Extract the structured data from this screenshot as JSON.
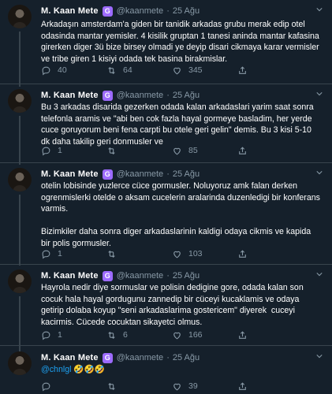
{
  "author": {
    "name": "M. Kaan Mete",
    "badge": "G",
    "handle": "@kaanmete",
    "separator": "·"
  },
  "tweets": [
    {
      "date": "25 Ağu",
      "text": "Arkadaşın amsterdam'a giden bir tanidik arkadas grubu merak edip otel odasinda mantar yemisler. 4 kisilik gruptan 1 tanesi aninda mantar kafasina girerken diger 3ü bize birsey olmadi ye deyip disari cikmaya karar vermisler ve tribe giren 1 kisiyi odada tek basina birakmislar.",
      "replies": "40",
      "retweets": "64",
      "likes": "345"
    },
    {
      "date": "25 Ağu",
      "text": "Bu 3 arkadas disarida gezerken odada kalan arkadaslari yarim saat sonra telefonla aramis ve \"abi ben cok fazla hayal gormeye basladim, her yerde cuce goruyorum beni fena carpti bu otele geri gelin\" demis. Bu 3 kisi 5-10 dk daha takilip geri donmusler ve",
      "replies": "1",
      "retweets": "",
      "likes": "85"
    },
    {
      "date": "25 Ağu",
      "text": "otelin lobisinde yuzlerce cüce gormusler. Noluyoruz amk falan derken ogrenmislerki otelde o aksam cucelerin aralarinda duzenledigi bir konferans varmis.\n\nBizimkiler daha sonra diger arkadaslarinin kaldigi odaya cikmis ve kapida bir polis gormusler.",
      "replies": "1",
      "retweets": "",
      "likes": "103"
    },
    {
      "date": "25 Ağu",
      "text": "Hayrola nedir diye sormuslar ve polisin dedigine gore, odada kalan son cocuk hala hayal gordugunu zannedip bir cüceyi kucaklamis ve odaya getirip dolaba koyup \"seni arkadaslarima gostericem\" diyerek  cuceyi kacirmis. Cücede cocuktan sikayetci olmus.",
      "replies": "1",
      "retweets": "6",
      "likes": "166"
    },
    {
      "date": "25 Ağu",
      "mention": "@chnlgl",
      "text": " 🤣🤣🤣",
      "replies": "",
      "retweets": "",
      "likes": "39"
    }
  ]
}
